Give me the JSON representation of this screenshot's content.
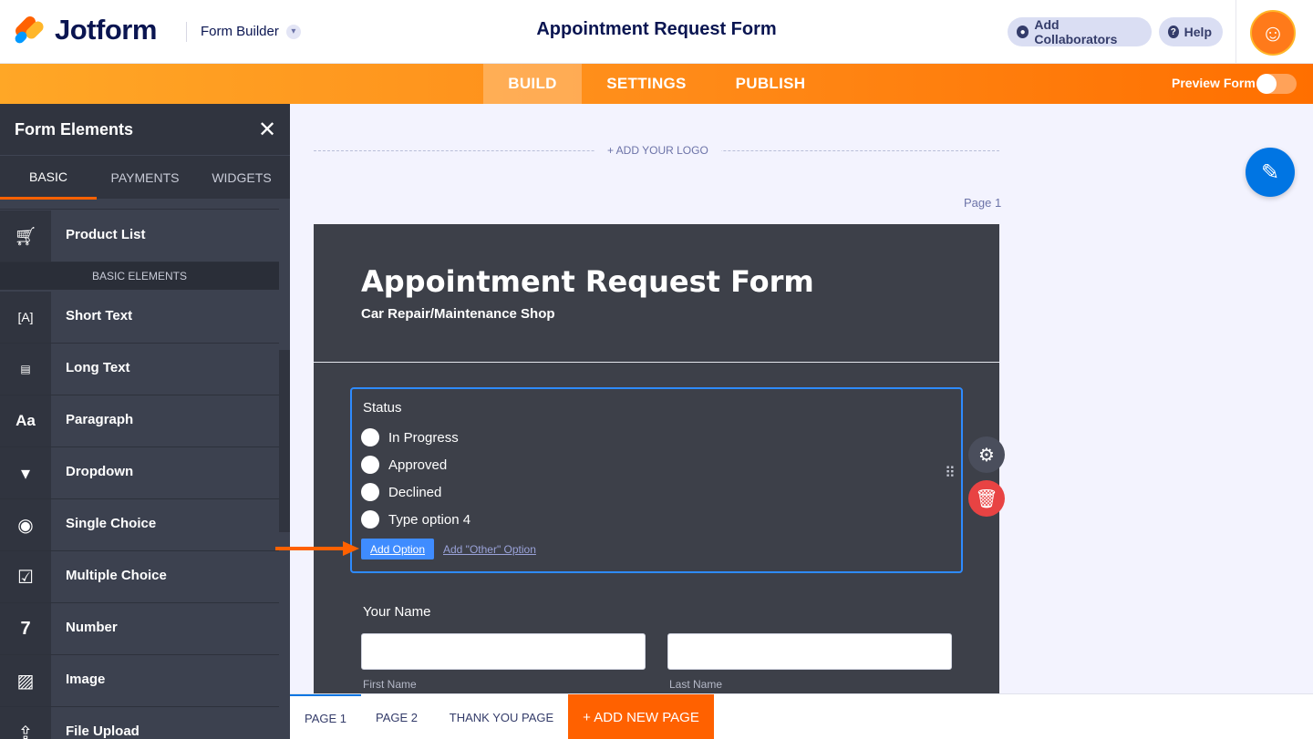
{
  "header": {
    "logo_text": "Jotform",
    "product_label": "Form Builder",
    "document_title": "Appointment Request Form",
    "collab_label": "Add Collaborators",
    "help_label": "Help"
  },
  "nav": {
    "tabs": [
      "BUILD",
      "SETTINGS",
      "PUBLISH"
    ],
    "active_tab": "BUILD",
    "preview_label": "Preview Form",
    "preview_on": false
  },
  "sidebar": {
    "title": "Form Elements",
    "tabs": [
      "BASIC",
      "PAYMENTS",
      "WIDGETS"
    ],
    "active_tab": "BASIC",
    "section_label": "BASIC ELEMENTS",
    "product_item": {
      "label": "Product List",
      "icon": "cart-icon"
    },
    "items": [
      {
        "label": "Short Text",
        "icon": "short-text-icon"
      },
      {
        "label": "Long Text",
        "icon": "long-text-icon"
      },
      {
        "label": "Paragraph",
        "icon": "paragraph-icon"
      },
      {
        "label": "Dropdown",
        "icon": "dropdown-icon"
      },
      {
        "label": "Single Choice",
        "icon": "radio-icon"
      },
      {
        "label": "Multiple Choice",
        "icon": "checkbox-icon"
      },
      {
        "label": "Number",
        "icon": "number-icon"
      },
      {
        "label": "Image",
        "icon": "image-icon"
      },
      {
        "label": "File Upload",
        "icon": "upload-icon"
      }
    ]
  },
  "canvas": {
    "add_logo": "+ ADD YOUR LOGO",
    "page_label": "Page 1"
  },
  "form": {
    "title": "Appointment Request Form",
    "subtitle": "Car Repair/Maintenance Shop",
    "question": {
      "label": "Status",
      "options": [
        "In Progress",
        "Approved",
        "Declined",
        "Type option 4"
      ],
      "add_option": "Add Option",
      "add_other": "Add \"Other\" Option"
    },
    "name_field": {
      "label": "Your Name",
      "first_sublabel": "First Name",
      "last_sublabel": "Last Name"
    }
  },
  "pages": {
    "tabs": [
      "PAGE 1",
      "PAGE 2",
      "THANK YOU PAGE"
    ],
    "add_page": "+ ADD NEW PAGE"
  },
  "colors": {
    "accent": "#ff6100",
    "selection": "#2e8bff",
    "form_bg": "#3d4049",
    "delete": "#e84343"
  }
}
